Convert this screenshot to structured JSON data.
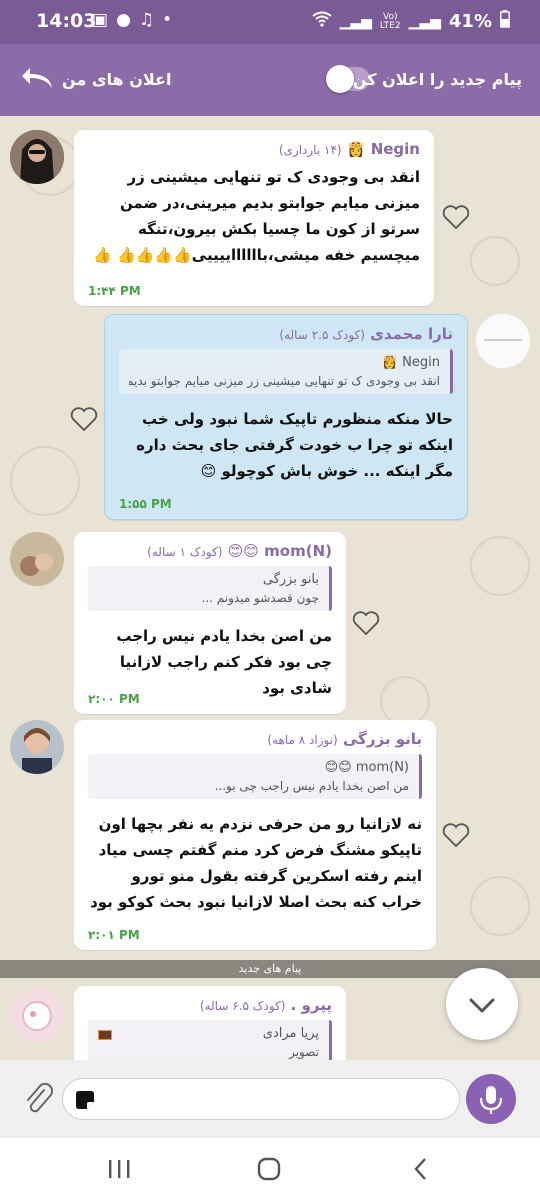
{
  "status_bar": {
    "time": "14:03",
    "network": "Vo)\nLTE2",
    "battery": "41%"
  },
  "header": {
    "title": "اعلان های من",
    "announce_label": "پیام جدید را اعلان کن",
    "toggle_on": false
  },
  "messages": [
    {
      "sender": "Negin",
      "sender_meta": "(۱۴ بارداری)",
      "text": "انقد بی وجودی ک تو تنهایی میشینی زر میزنی میایم جوابتو بدیم میرینی،در ضمن سرتو از کون ما چسیا بکش بیرون،تنگه میچسیم خفه میشی،بااااااییییی👍👍👍👍 👍",
      "time": "1:۴۴ PM"
    },
    {
      "sender": "تارا محمدی",
      "sender_meta": "(کودک ۲.۵ ساله)",
      "quote_name": "Negin 👸",
      "quote_text": "انقد بی وجودی ک تو تنهایی میشینی زر میزنی میایم جوابتو بدیم ...",
      "text": "حالا منکه منظورم تاپیک شما نبود ولی خب اینکه تو چرا ب خودت گرفتی جای بحث داره مگر اینکه ... خوش باش کوچولو 😊",
      "time": "1:۵۵ PM"
    },
    {
      "sender": "mom(N) 😊😊",
      "sender_meta": "(کودک ۱ ساله)",
      "quote_name": "بانو بزرگی",
      "quote_text": "چون قصدشو میدونم ...",
      "text": "من اصن بخدا یادم نیس راجب چی بود فکر کنم راجب لازانیا شادی بود",
      "time": "۲:۰۰ PM"
    },
    {
      "sender": "بانو بزرگی",
      "sender_meta": "(نوزاد ۸ ماهه)",
      "quote_name": "mom(N) 😊😊",
      "quote_text": "من اصن بخدا یادم نیس راجب چی بو...",
      "text": "نه لازانیا رو من حرفی نزدم یه نفر بچها اون تاپیکو مشنگ فرض کرد منم گفتم چسی میاد اینم رفته اسکرین گرفته بقول منو تورو خراب کنه بحث اصلا لازانیا نبود بحث کوکو بود",
      "time": "۲:۰۱ PM"
    },
    {
      "sender": "پپرو .",
      "sender_meta": "(کودک ۶.۵ ساله)",
      "quote_name": "پریا مرادی",
      "quote_text": "تصویر"
    }
  ],
  "new_messages_divider": "پیام های جدید",
  "icons": {
    "back": "back-arrow-icon",
    "heart": "heart-outline-icon",
    "attach": "paperclip-icon",
    "mic": "microphone-icon",
    "scroll": "chevron-down-icon"
  },
  "colors": {
    "header": "#8c6ca8",
    "accent": "#8a6aa8",
    "outgoing_bubble": "#cfe7f5",
    "time": "#4aa14a",
    "mic": "#8b61b3"
  }
}
